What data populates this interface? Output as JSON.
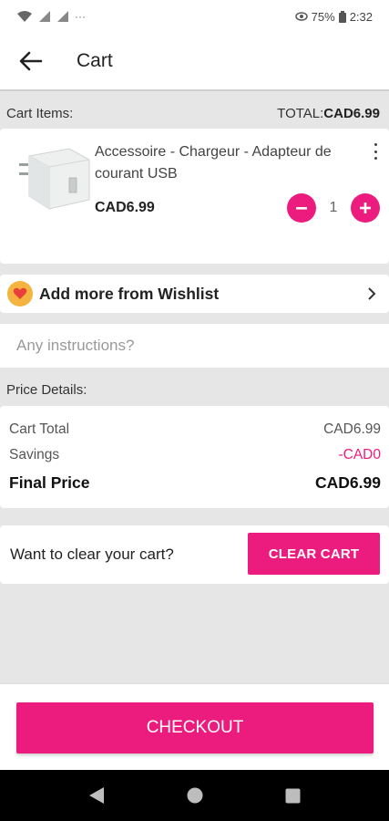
{
  "status_bar": {
    "battery": "75%",
    "time": "2:32",
    "dots": "···"
  },
  "header": {
    "title": "Cart"
  },
  "cart_items": {
    "label": "Cart Items:",
    "total_prefix": "TOTAL:",
    "total_value": "CAD6.99",
    "items": [
      {
        "name": "Accessoire - Chargeur - Adapteur de courant USB",
        "price": "CAD6.99",
        "quantity": "1"
      }
    ]
  },
  "wishlist": {
    "label": "Add more from Wishlist"
  },
  "instructions": {
    "placeholder": "Any instructions?",
    "value": ""
  },
  "price_details": {
    "label": "Price Details:",
    "rows": [
      {
        "label": "Cart Total",
        "value": "CAD6.99"
      },
      {
        "label": "Savings",
        "value": "-CAD0"
      },
      {
        "label": "Final Price",
        "value": "CAD6.99"
      }
    ]
  },
  "clear_cart": {
    "prompt": "Want to clear your cart?",
    "button_label": "CLEAR CART"
  },
  "checkout": {
    "label": "CHECKOUT"
  },
  "colors": {
    "accent": "#ec1c7e",
    "wishlist_badge": "#f5b340",
    "background": "#e6e6e6"
  },
  "icons": [
    "back-arrow-icon",
    "more-vertical-icon",
    "minus-icon",
    "plus-icon",
    "heart-icon",
    "chevron-right-icon",
    "nav-back-icon",
    "nav-home-icon",
    "nav-recents-icon"
  ]
}
